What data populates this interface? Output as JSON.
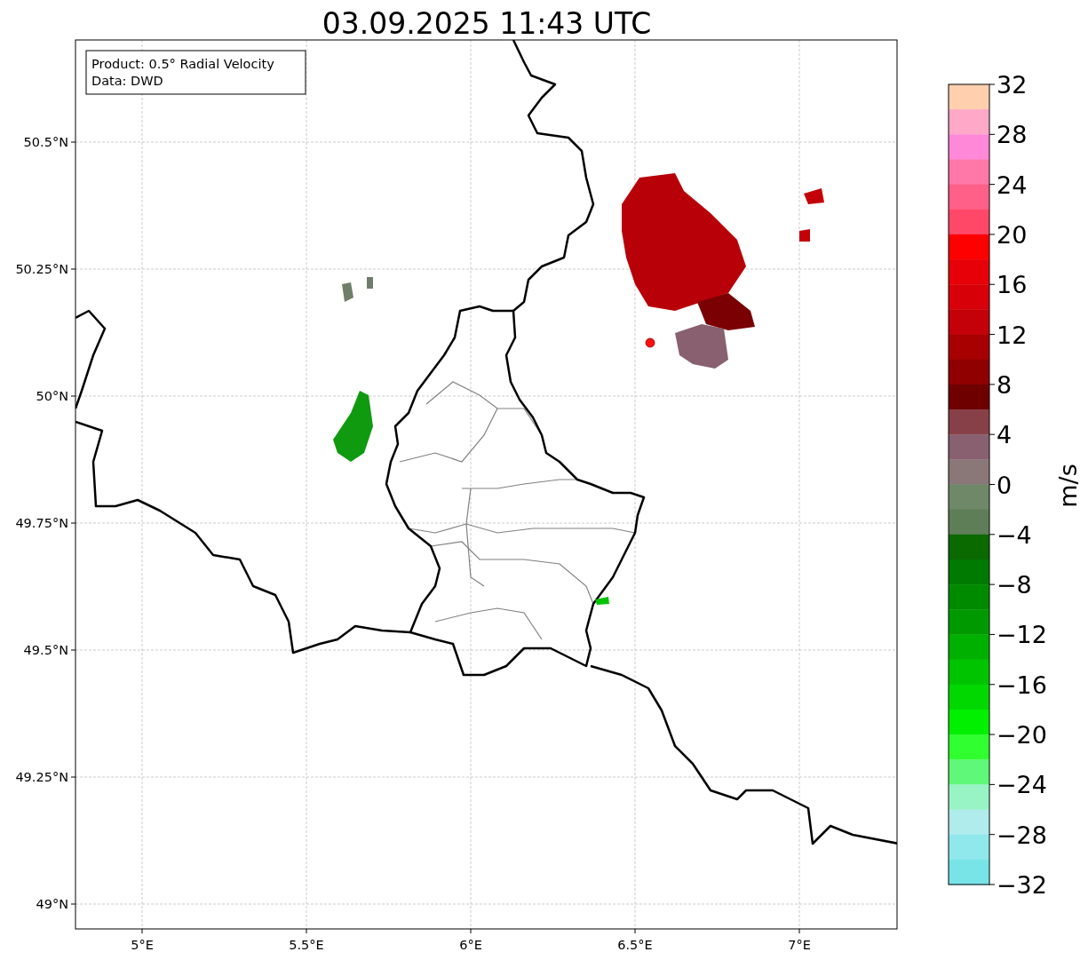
{
  "title": "03.09.2025 11:43 UTC",
  "info_box": [
    "Product: 0.5° Radial Velocity",
    "Data: DWD"
  ],
  "map": {
    "lat_ticks": [
      "50.5°N",
      "50.25°N",
      "50°N",
      "49.75°N",
      "49.5°N",
      "49.25°N",
      "49°N"
    ],
    "lon_ticks": [
      "5°E",
      "5.5°E",
      "6°E",
      "6.5°E",
      "7°E"
    ]
  },
  "colorbar": {
    "label": "m/s",
    "ticks": [
      "32",
      "28",
      "24",
      "20",
      "16",
      "12",
      "8",
      "4",
      "0",
      "−4",
      "−8",
      "−12",
      "−16",
      "−20",
      "−24",
      "−28",
      "−32"
    ],
    "segments": [
      {
        "color": "#ffcfae"
      },
      {
        "color": "#ffa8c8"
      },
      {
        "color": "#ff88d8"
      },
      {
        "color": "#ff78a8"
      },
      {
        "color": "#ff6088"
      },
      {
        "color": "#ff4868"
      },
      {
        "color": "#ff0000"
      },
      {
        "color": "#e80008"
      },
      {
        "color": "#d80008"
      },
      {
        "color": "#c40008"
      },
      {
        "color": "#a80000"
      },
      {
        "color": "#900000"
      },
      {
        "color": "#6e0000"
      },
      {
        "color": "#884048"
      },
      {
        "color": "#886070"
      },
      {
        "color": "#8a7878"
      },
      {
        "color": "#6e8868"
      },
      {
        "color": "#5e7e58"
      },
      {
        "color": "#0a6a00"
      },
      {
        "color": "#007a00"
      },
      {
        "color": "#008a00"
      },
      {
        "color": "#009a00"
      },
      {
        "color": "#00b000"
      },
      {
        "color": "#00c400"
      },
      {
        "color": "#00d800"
      },
      {
        "color": "#00f000"
      },
      {
        "color": "#30ff30"
      },
      {
        "color": "#60f878"
      },
      {
        "color": "#98f4c4"
      },
      {
        "color": "#b0ecec"
      },
      {
        "color": "#90e8ec"
      },
      {
        "color": "#78e4e8"
      }
    ]
  }
}
